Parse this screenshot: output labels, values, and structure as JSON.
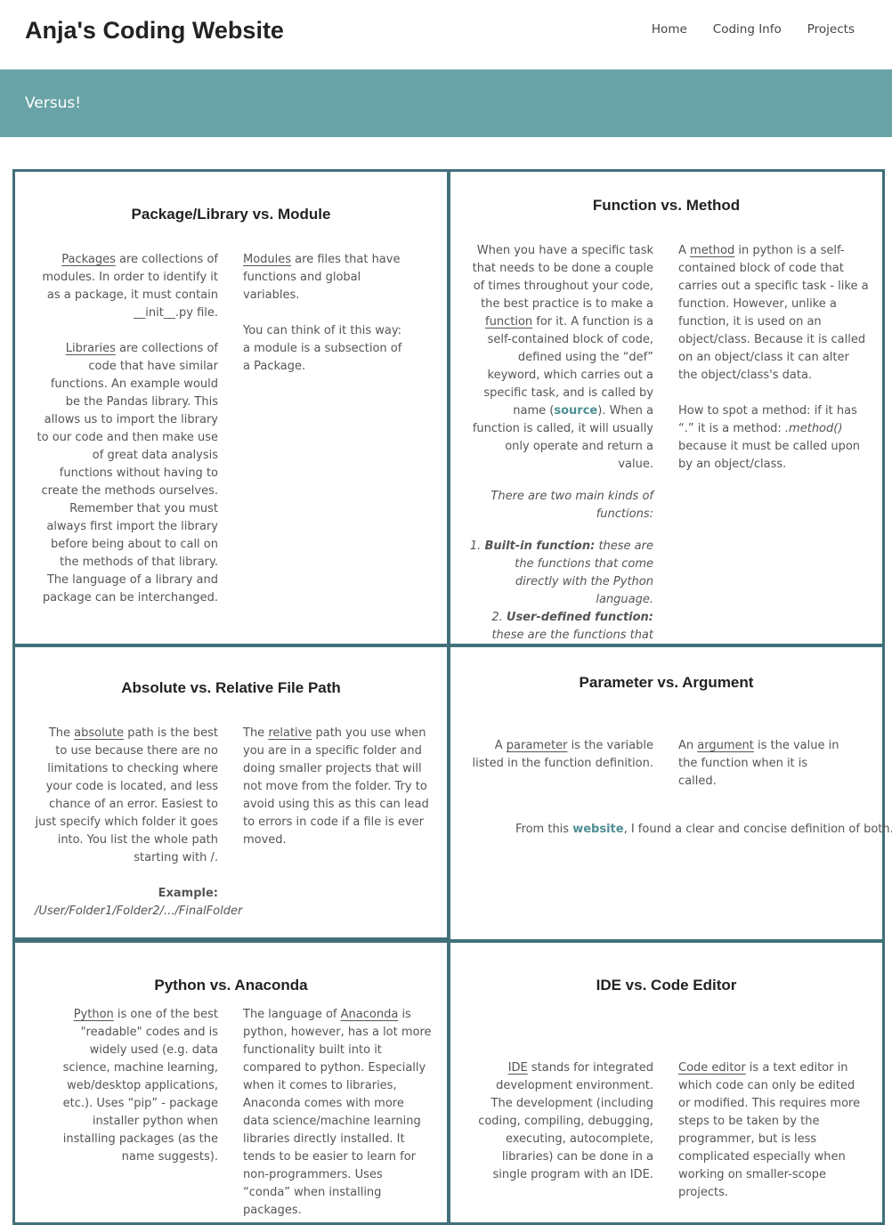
{
  "site": {
    "title": "Anja's Coding Website"
  },
  "nav": {
    "items": [
      "Home",
      "Coding Info",
      "Projects"
    ]
  },
  "banner": {
    "text": "Versus!"
  },
  "pkg": {
    "title": "Package/Library vs. Module",
    "left1": {
      "term": "Packages",
      "text": " are collections of modules. In order to identify it as a package, it must contain __init__.py file."
    },
    "left2": {
      "term": "Libraries",
      "text": " are collections of code that have similar functions. An example would be the Pandas library. This allows us to import the library to our code and then make use of great data analysis functions without having to create the methods ourselves. Remember that you must always first import the library before being about to call on the methods of that library. The language of a library and package can be interchanged."
    },
    "right1": {
      "term": "Modules",
      "text": " are files that have functions and global variables."
    },
    "right2": "You can think of it this way: a module is a subsection of a Package."
  },
  "func": {
    "title": "Function vs. Method",
    "left1a": "When you have a specific task that needs to be done a couple of times throughout your code, the best practice is to make a ",
    "left1_term": "function",
    "left1b": " for it. A function is a self-contained block of code, defined using the “def” keyword, which carries out a specific task, and is called by name (",
    "source_link": "source",
    "left1c": "). When a function is called, it will usually only operate and return a value.",
    "kinds_intro": "There are two main kinds of functions:",
    "kind1_num": "1. ",
    "kind1_bold": "Built-in function:",
    "kind1_text": " these are the functions that come directly with the Python language.",
    "kind2_num": "2. ",
    "kind2_bold": "User-defined function:",
    "kind2_text": " these are the functions that you would create in order to help you execute.",
    "right1a": "A ",
    "right1_term": "method",
    "right1b": " in python is a self-contained block of code that carries out a specific task - like a function. However, unlike a function, it is used on an object/class. Because it is called on an object/class it can alter the object/class's data.",
    "right2a": "How to spot a method: if it has “.” it is a method: ",
    "right2_code": ".method()",
    "right2b": " because it must be called upon by an object/class."
  },
  "path": {
    "title": "Absolute vs. Relative File Path",
    "left_a": "The ",
    "left_term": "absolute",
    "left_b": " path is the best to use because there are no limitations to checking where your code is located, and less chance of an error. Easiest to just specify which folder it goes into. You list the whole path starting with /.",
    "example_label": "Example:",
    "example_path": "/User/Folder1/Folder2/.../FinalFolder",
    "right_a": "The ",
    "right_term": "relative",
    "right_b": " path you use when you are in a specific folder and doing smaller projects that will not move from the folder. Try to avoid using this as this can lead to errors in code if a file is ever moved."
  },
  "param": {
    "title": "Parameter vs. Argument",
    "left_a": "A ",
    "left_term": "parameter",
    "left_b": " is the variable listed in the function definition.",
    "right_a": "An ",
    "right_term": "argument",
    "right_b": " is the value in the function when it is called.",
    "footer_a": "From this ",
    "footer_link": "website",
    "footer_b": ", I found a clear and concise definition of both."
  },
  "py": {
    "title": "Python vs. Anaconda",
    "left_term": "Python",
    "left_text": " is one of the best \"readable\" codes and is widely used (e.g. data science, machine learning, web/desktop applications, etc.). Uses “pip” - package installer python when installing packages (as the name suggests).",
    "right_a": "The language of ",
    "right_term": "Anaconda",
    "right_b": " is python, however, has a lot more functionality built into it compared to python. Especially when it comes to libraries, Anaconda comes with more data science/machine learning libraries directly installed. It tends to be easier to learn for non-programmers. Uses “conda” when installing packages."
  },
  "ide": {
    "title": "IDE vs. Code Editor",
    "left_term": "IDE",
    "left_text": " stands for integrated development environment. The development (including coding, compiling, debugging, executing, autocomplete, libraries) can be done in a single program with an IDE.",
    "right_term": "Code editor",
    "right_text": " is a text editor in which code can only be edited or modified. This requires more steps to be taken by the programmer, but is less complicated especially when working on smaller-scope projects."
  }
}
